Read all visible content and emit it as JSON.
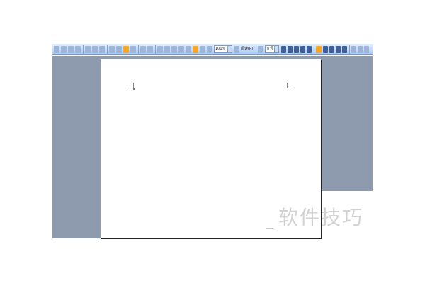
{
  "toolbar": {
    "zoom_value": "100%",
    "read_button_label": "阅读(R)",
    "font_size_value": "五号"
  },
  "watermark": {
    "text": "软件技巧"
  },
  "colors": {
    "workspace": "#8e9aae",
    "toolbar": "#c4dafa",
    "page": "#ffffff",
    "watermark": "#d2d2d2",
    "highlight_button": "#f5a623"
  }
}
